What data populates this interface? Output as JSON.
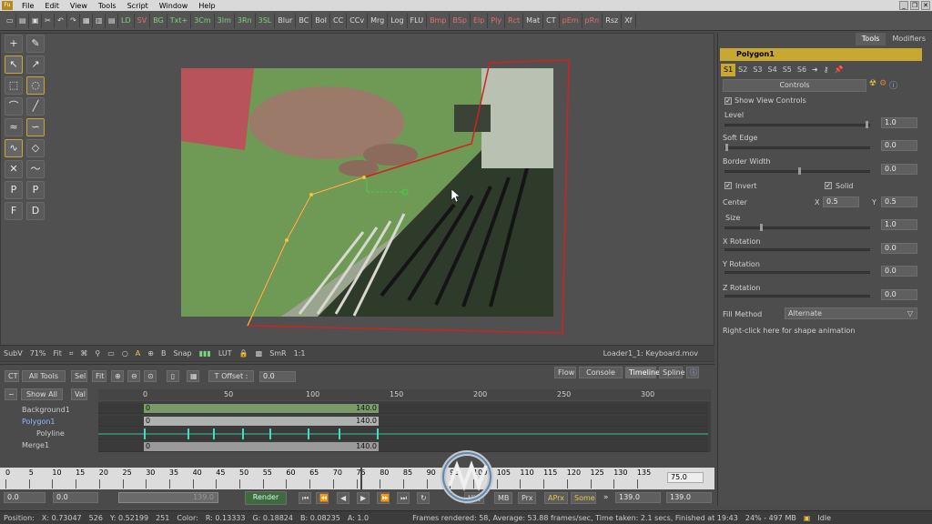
{
  "menubar": {
    "items": [
      "File",
      "Edit",
      "View",
      "Tools",
      "Script",
      "Window",
      "Help"
    ]
  },
  "toolbar": {
    "buttons": [
      {
        "label": "LD",
        "color": "g"
      },
      {
        "label": "SV",
        "color": "r"
      },
      {
        "label": "BG",
        "color": "g"
      },
      {
        "label": "Txt+",
        "color": "g"
      },
      {
        "label": "3Cm",
        "color": "g"
      },
      {
        "label": "3Im",
        "color": "g"
      },
      {
        "label": "3Rn",
        "color": "g"
      },
      {
        "label": "3SL",
        "color": "g"
      },
      {
        "label": "Blur",
        "color": ""
      },
      {
        "label": "BC",
        "color": ""
      },
      {
        "label": "BoI",
        "color": ""
      },
      {
        "label": "CC",
        "color": ""
      },
      {
        "label": "CCv",
        "color": ""
      },
      {
        "label": "Mrg",
        "color": ""
      },
      {
        "label": "Log",
        "color": ""
      },
      {
        "label": "FLU",
        "color": ""
      },
      {
        "label": "Bmp",
        "color": "r"
      },
      {
        "label": "BSp",
        "color": "r"
      },
      {
        "label": "Elp",
        "color": "r"
      },
      {
        "label": "Ply",
        "color": "r"
      },
      {
        "label": "Rct",
        "color": "r"
      },
      {
        "label": "Mat",
        "color": ""
      },
      {
        "label": "CT",
        "color": ""
      },
      {
        "label": "pEm",
        "color": "r"
      },
      {
        "label": "pRn",
        "color": "r"
      },
      {
        "label": "Rsz",
        "color": ""
      },
      {
        "label": "Xf",
        "color": ""
      }
    ]
  },
  "viewer": {
    "subview": "SubV",
    "zoom": "71%",
    "fit": "Fit",
    "snap": "Snap",
    "lut": "LUT",
    "smr": "SmR",
    "ratio": "1:1",
    "loader": "Loader1_1: Keyboard.mov",
    "a": "A",
    "b": "B"
  },
  "right_panel": {
    "tabs": [
      "Tools",
      "Modifiers"
    ],
    "tool_name": "Polygon1",
    "subtabs": [
      "S1",
      "S2",
      "S3",
      "S4",
      "S5",
      "S6"
    ],
    "controls_label": "Controls",
    "show_view_controls": "Show View Controls",
    "level": {
      "label": "Level",
      "value": "1.0"
    },
    "soft_edge": {
      "label": "Soft Edge",
      "value": "0.0"
    },
    "border_width": {
      "label": "Border Width",
      "value": "0.0"
    },
    "invert": "Invert",
    "solid": "Solid",
    "center": {
      "label": "Center",
      "x_label": "X",
      "x": "0.5",
      "y_label": "Y",
      "y": "0.5"
    },
    "size": {
      "label": "Size",
      "value": "1.0"
    },
    "x_rotation": {
      "label": "X Rotation",
      "value": "0.0"
    },
    "y_rotation": {
      "label": "Y Rotation",
      "value": "0.0"
    },
    "z_rotation": {
      "label": "Z Rotation",
      "value": "0.0"
    },
    "fill_method": {
      "label": "Fill Method",
      "value": "Alternate"
    },
    "hint": "Right-click here for shape animation"
  },
  "timeline": {
    "ct": "CT",
    "all_tools": "All Tools",
    "sel": "Sel",
    "fit": "Fit",
    "t_offset_label": "T Offset :",
    "t_offset": "0.0",
    "tabs": [
      "Flow",
      "Console",
      "Timeline",
      "Spline"
    ],
    "show_all": "Show All",
    "val": "Val",
    "ruler": [
      "0",
      "50",
      "100",
      "150",
      "200",
      "250",
      "300"
    ],
    "tracks": [
      {
        "name": "Background1",
        "start": "0",
        "end": "140.0"
      },
      {
        "name": "Polygon1",
        "start": "0",
        "end": "140.0"
      },
      {
        "name": "Polyline",
        "start": "",
        "end": ""
      },
      {
        "name": "Merge1",
        "start": "0",
        "end": "140.0"
      }
    ]
  },
  "frame_ruler": {
    "ticks": [
      "0",
      "5",
      "10",
      "15",
      "20",
      "25",
      "30",
      "35",
      "40",
      "45",
      "50",
      "55",
      "60",
      "65",
      "70",
      "75",
      "80",
      "85",
      "90",
      "95",
      "100",
      "105",
      "110",
      "115",
      "120",
      "125",
      "130",
      "135"
    ],
    "current": "75.0"
  },
  "transport": {
    "start": "0.0",
    "render_start": "0.0",
    "render_end": "139.0",
    "render": "Render",
    "hiq": "HiQ",
    "mb": "MB",
    "prx": "Prx",
    "aprx": "APrx",
    "some": "Some",
    "end": "139.0",
    "global_end": "139.0"
  },
  "status": {
    "position": "Position:",
    "x": "X: 0.73047",
    "xi": "526",
    "y": "Y: 0.52199",
    "yi": "251",
    "color": "Color:",
    "r": "R: 0.13333",
    "g": "G: 0.18824",
    "b": "B: 0.08235",
    "a": "A: 1.0",
    "frames": "Frames rendered: 58, Average: 53.88 frames/sec, Time taken: 2.1 secs, Finished at 19:43",
    "mem": "24% - 497 MB",
    "idle": "Idle"
  }
}
